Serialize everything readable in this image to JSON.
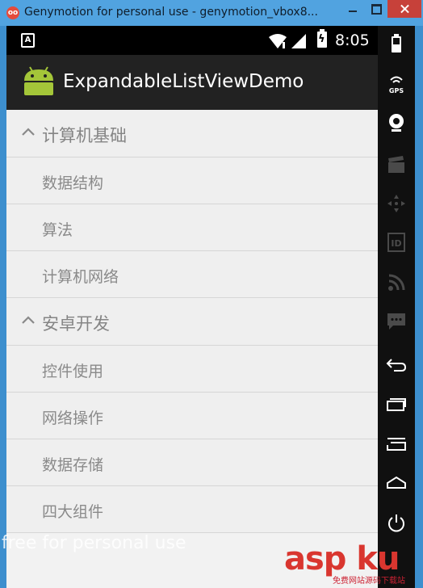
{
  "window": {
    "title": "Genymotion for personal use - genymotion_vbox8...",
    "logo_glyph": "oo"
  },
  "statusbar": {
    "notification": "A",
    "time": "8:05"
  },
  "app": {
    "title": "ExpandableListViewDemo"
  },
  "list": {
    "groups": [
      {
        "label": "计算机基础",
        "expanded": true,
        "children": [
          "数据结构",
          "算法",
          "计算机网络"
        ]
      },
      {
        "label": "安卓开发",
        "expanded": true,
        "children": [
          "控件使用",
          "网络操作",
          "数据存储",
          "四大组件"
        ]
      }
    ]
  },
  "sidebar": {
    "gps_label": "GPS",
    "id_label": "ID",
    "icons": [
      "battery-icon",
      "gps-icon",
      "webcam-icon",
      "video-clapper-icon",
      "dpad-icon",
      "id-icon",
      "rss-icon",
      "sms-icon",
      "back-icon",
      "recent-apps-icon",
      "menu-icon",
      "home-icon",
      "power-icon"
    ]
  },
  "watermark": {
    "text": "free for personal use"
  },
  "corner_logo": {
    "text": "asp ku",
    "subtitle": "免费网站源码下载站"
  },
  "colors": {
    "titlebar": "#51a3e0",
    "close_button": "#c7413a",
    "appbar": "#222222",
    "android_green": "#a4c639",
    "list_bg": "#efefef"
  }
}
